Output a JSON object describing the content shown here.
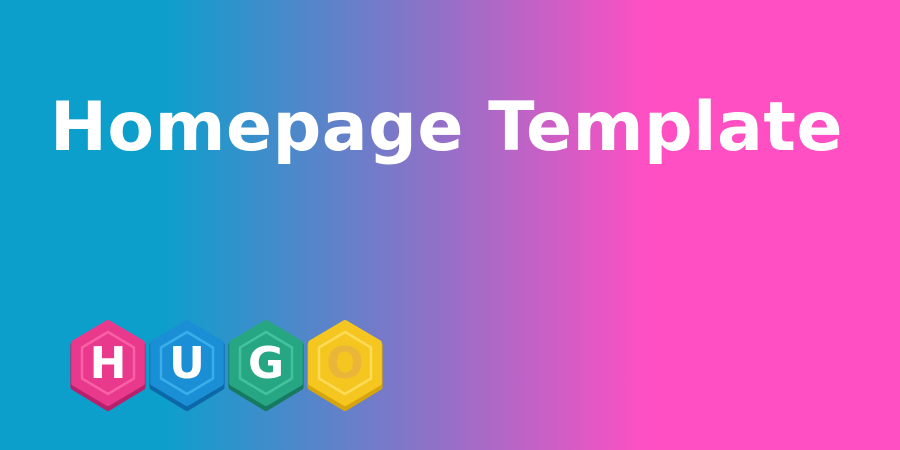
{
  "banner": {
    "title": "Homepage Template",
    "gradient": {
      "start": "#0c9fcc",
      "mid": "#8a73c8",
      "end": "#ff4fc3"
    }
  },
  "logo": {
    "letters": [
      {
        "char": "H",
        "icon": "hexagon-h-icon",
        "color": "#e8398d",
        "light": "#ff6aad",
        "dark": "#b8206b",
        "text": "#ffffff"
      },
      {
        "char": "U",
        "icon": "hexagon-u-icon",
        "color": "#1b8fd6",
        "light": "#43b4f0",
        "dark": "#0d68a8",
        "text": "#ffffff"
      },
      {
        "char": "G",
        "icon": "hexagon-g-icon",
        "color": "#27a683",
        "light": "#4cc9a4",
        "dark": "#167a60",
        "text": "#ffffff"
      },
      {
        "char": "O",
        "icon": "hexagon-o-icon",
        "color": "#f5c61f",
        "light": "#ffe066",
        "dark": "#d6a40c",
        "text": "#e9b63a"
      }
    ]
  }
}
